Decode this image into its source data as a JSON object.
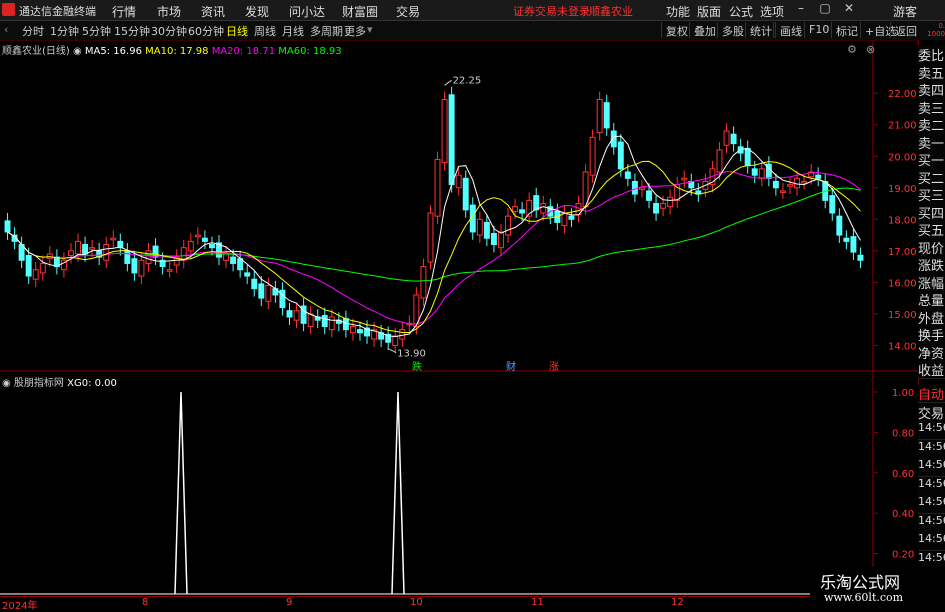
{
  "menubar": {
    "app_title": "通达信金融终端",
    "items": [
      "行情",
      "市场",
      "资讯",
      "发现",
      "问小达",
      "财富圈",
      "交易"
    ],
    "warning": "证券交易未登录",
    "stock_name": "顺鑫农业",
    "right_items": [
      "功能",
      "版面",
      "公式",
      "选项"
    ],
    "user": "游客"
  },
  "toolbar": {
    "periods": [
      "分时",
      "1分钟",
      "5分钟",
      "15分钟",
      "30分钟",
      "60分钟",
      "日线",
      "周线",
      "月线",
      "多周期",
      "更多"
    ],
    "active_period": "日线",
    "right_tools": [
      "复权",
      "叠加",
      "多股",
      "统计",
      "画线",
      "F10",
      "标记",
      "+自选",
      "返回"
    ]
  },
  "main_legend": {
    "title": "顺鑫农业(日线)",
    "ma5": "MA5: 16.96",
    "ma10": "MA10: 17.98",
    "ma20": "MA20: 18.71",
    "ma60": "MA60: 18.93"
  },
  "sub_legend": {
    "title": "股朋指标网",
    "xg": "XG0: 0.00"
  },
  "annotations": {
    "high": "22.25",
    "low": "13.90",
    "die": "跌",
    "cai": "财",
    "zhang": "涨"
  },
  "price_axis": [
    "22.00",
    "21.00",
    "20.00",
    "19.00",
    "18.00",
    "17.00",
    "16.00",
    "15.00",
    "14.00"
  ],
  "sub_axis": [
    "1.00",
    "0.80",
    "0.60",
    "0.40",
    "0.20"
  ],
  "time_axis": [
    "2024年",
    "8",
    "9",
    "10",
    "11",
    "12"
  ],
  "side_panel": [
    "委比",
    "卖五",
    "卖四",
    "卖三",
    "卖二",
    "卖一",
    "买一",
    "买二",
    "买三",
    "买四",
    "买五",
    "现价",
    "涨跌",
    "涨幅",
    "总量",
    "外盘",
    "换手",
    "净资",
    "收益"
  ],
  "side_panel2": [
    "自动",
    "交易",
    "14:56",
    "14:56",
    "14:56",
    "14:56",
    "14:56",
    "14:56",
    "14:56",
    "14:56",
    "14:56"
  ],
  "colors": {
    "up": "#ff3232",
    "down": "#54ffff",
    "ma5": "#ffffff",
    "ma10": "#ffff00",
    "ma20": "#ff00ff",
    "ma60": "#00ff00"
  },
  "chart_data": {
    "type": "candlestick",
    "price_range": [
      13.6,
      22.8
    ],
    "high_mark": 22.25,
    "low_mark": 13.9,
    "closes": [
      17.6,
      17.3,
      16.7,
      16.2,
      16.4,
      16.6,
      16.9,
      16.5,
      16.7,
      17.0,
      17.3,
      16.9,
      17.1,
      16.8,
      17.2,
      17.4,
      17.1,
      16.6,
      16.3,
      16.7,
      17.0,
      16.8,
      16.5,
      16.4,
      16.8,
      17.1,
      17.3,
      17.5,
      17.3,
      17.1,
      16.8,
      16.9,
      16.6,
      16.4,
      16.2,
      15.8,
      15.5,
      15.9,
      15.6,
      15.2,
      14.9,
      15.1,
      14.7,
      15.0,
      14.8,
      14.6,
      14.9,
      14.7,
      14.5,
      14.6,
      14.4,
      14.3,
      14.5,
      14.2,
      14.1,
      14.3,
      14.5,
      14.7,
      15.6,
      16.5,
      18.2,
      19.9,
      21.8,
      19.1,
      19.4,
      18.3,
      17.6,
      18.0,
      17.4,
      17.2,
      17.6,
      18.1,
      18.4,
      18.2,
      18.6,
      18.3,
      18.5,
      18.1,
      17.9,
      18.2,
      18.0,
      18.5,
      19.5,
      20.6,
      21.8,
      20.9,
      20.3,
      19.6,
      19.3,
      18.8,
      19.0,
      18.6,
      18.2,
      18.5,
      18.7,
      19.1,
      19.3,
      19.0,
      18.8,
      19.2,
      19.6,
      20.2,
      20.8,
      20.4,
      20.1,
      19.7,
      19.4,
      19.6,
      19.3,
      19.0,
      18.9,
      19.1,
      19.3,
      19.2,
      19.5,
      19.3,
      18.6,
      18.2,
      17.5,
      17.3,
      16.96,
      16.7
    ],
    "volume": [],
    "xg0": {
      "signal_days": [
        1,
        1
      ],
      "value": 0.0
    }
  }
}
